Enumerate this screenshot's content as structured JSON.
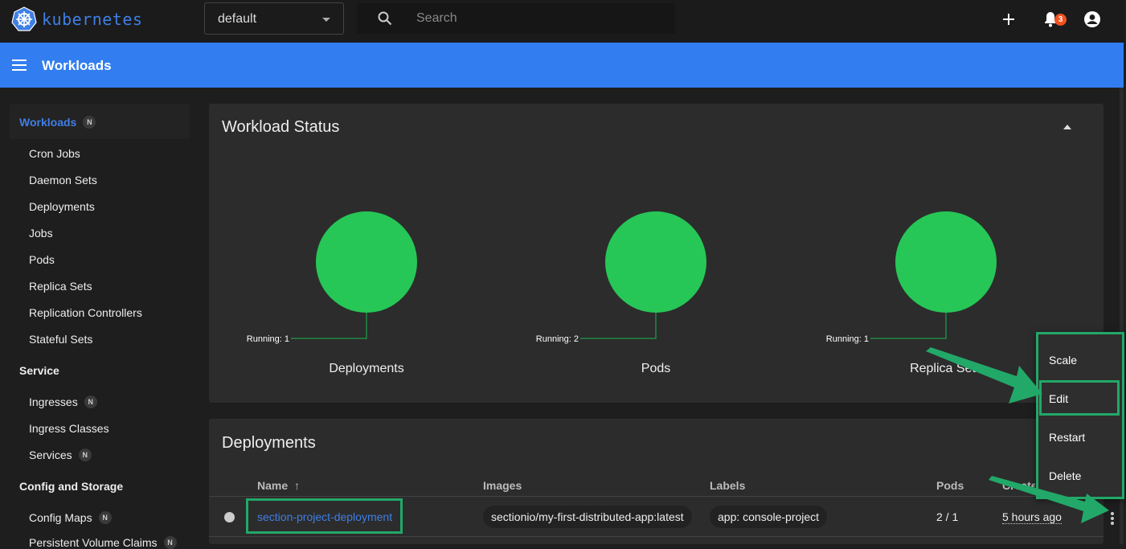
{
  "topbar": {
    "brand": "kubernetes",
    "namespace": "default",
    "search_placeholder": "Search",
    "notification_count": "3",
    "icons": {
      "logo": "kubernetes-helm-icon",
      "search": "search-icon",
      "create": "plus-icon",
      "notifications": "bell-icon",
      "account": "account-circle-icon",
      "namespace_caret": "caret-down-icon"
    }
  },
  "appbar": {
    "title": "Workloads",
    "menu_icon": "hamburger-menu-icon"
  },
  "sidebar": {
    "active": "Workloads",
    "n_badge": "N",
    "groups": [
      {
        "label": "Workloads",
        "badge": "N",
        "items": [
          {
            "label": "Cron Jobs"
          },
          {
            "label": "Daemon Sets"
          },
          {
            "label": "Deployments"
          },
          {
            "label": "Jobs"
          },
          {
            "label": "Pods"
          },
          {
            "label": "Replica Sets"
          },
          {
            "label": "Replication Controllers"
          },
          {
            "label": "Stateful Sets"
          }
        ]
      },
      {
        "label": "Service",
        "items": [
          {
            "label": "Ingresses",
            "badge": "N"
          },
          {
            "label": "Ingress Classes"
          },
          {
            "label": "Services",
            "badge": "N"
          }
        ]
      },
      {
        "label": "Config and Storage",
        "items": [
          {
            "label": "Config Maps",
            "badge": "N"
          },
          {
            "label": "Persistent Volume Claims",
            "badge": "N"
          }
        ]
      }
    ]
  },
  "workload_status": {
    "title": "Workload Status",
    "collapse_icon": "caret-up-icon",
    "status_color": "#26c756",
    "charts": [
      {
        "name": "Deployments",
        "label": "Running: 1",
        "running": 1
      },
      {
        "name": "Pods",
        "label": "Running: 2",
        "running": 2
      },
      {
        "name": "Replica Sets",
        "label": "Running: 1",
        "running": 1
      }
    ]
  },
  "deployments": {
    "title": "Deployments",
    "columns": [
      "Name",
      "Images",
      "Labels",
      "Pods",
      "Created"
    ],
    "sort_icon": "arrow-up-icon",
    "rows": [
      {
        "status_icon": "status-circle-icon",
        "name": "section-project-deployment",
        "image": "sectionio/my-first-distributed-app:latest",
        "label": "app: console-project",
        "pods": "2 / 1",
        "created": "5 hours ago"
      }
    ],
    "row_menu_icon": "more-vert-icon"
  },
  "context_menu": {
    "items": [
      "Scale",
      "Edit",
      "Restart",
      "Delete"
    ],
    "highlighted": "Edit"
  },
  "annotation": {
    "color": "#22a868"
  }
}
